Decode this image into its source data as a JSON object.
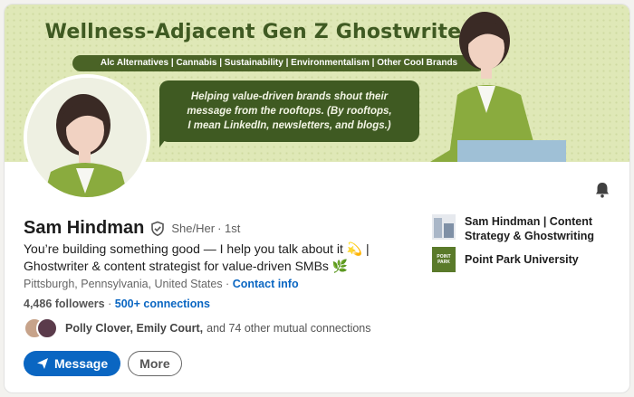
{
  "banner": {
    "title": "Wellness-Adjacent Gen Z Ghostwriter",
    "niches": "Alc Alternatives | Cannabis | Sustainability | Environmentalism | Other Cool Brands",
    "tagline": "Helping value-driven brands shout their\nmessage from the rooftops. (By rooftops,\nI mean LinkedIn, newsletters, and blogs.)",
    "colors": {
      "background": "#dfe8b7",
      "accent": "#3f5a22"
    }
  },
  "profile": {
    "name": "Sam Hindman",
    "pronouns": "She/Her",
    "degree": "· 1st",
    "headline": "You’re building something good — I help you talk about it 💫 | Ghostwriter & content strategist for value-driven SMBs 🌿",
    "location": "Pittsburgh, Pennsylvania, United States ·",
    "contact_link": "Contact info",
    "followers": "4,486 followers",
    "connections": "500+ connections",
    "mutual_names": "Polly Clover, Emily Court,",
    "mutual_rest": "and 74 other mutual connections"
  },
  "actions": {
    "message_label": "Message",
    "more_label": "More"
  },
  "orgs": [
    {
      "name": "Sam Hindman | Content Strategy & Ghostwriting",
      "icon": "company-logo"
    },
    {
      "name": "Point Park University",
      "icon": "university-logo",
      "logo_text": "POINT PARK"
    }
  ],
  "icons": {
    "notify": "bell-icon",
    "verified": "verified-shield-icon",
    "message": "send-icon"
  },
  "colors": {
    "link": "#0a66c2",
    "primary_button": "#0a66c2"
  }
}
